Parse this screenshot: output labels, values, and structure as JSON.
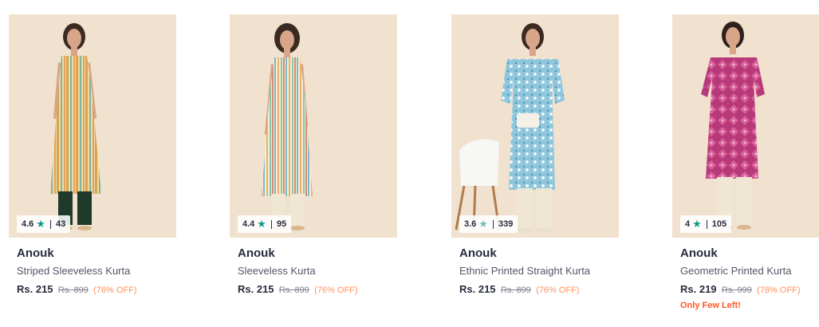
{
  "products": [
    {
      "brand": "Anouk",
      "name": "Striped Sleeveless Kurta",
      "rating": "4.6",
      "rating_count": "43",
      "price": "Rs. 215",
      "mrp": "Rs. 899",
      "discount": "(76% OFF)",
      "stock_note": "",
      "image_icon": "product-image",
      "star_color": "#14958f"
    },
    {
      "brand": "Anouk",
      "name": "Sleeveless Kurta",
      "rating": "4.4",
      "rating_count": "95",
      "price": "Rs. 215",
      "mrp": "Rs. 899",
      "discount": "(76% OFF)",
      "stock_note": "",
      "image_icon": "product-image",
      "star_color": "#14958f"
    },
    {
      "brand": "Anouk",
      "name": "Ethnic Printed Straight Kurta",
      "rating": "3.6",
      "rating_count": "339",
      "price": "Rs. 215",
      "mrp": "Rs. 899",
      "discount": "(76% OFF)",
      "stock_note": "",
      "image_icon": "product-image",
      "star_color": "#72bcb9"
    },
    {
      "brand": "Anouk",
      "name": "Geometric Printed Kurta",
      "rating": "4",
      "rating_count": "105",
      "price": "Rs. 219",
      "mrp": "Rs. 999",
      "discount": "(78% OFF)",
      "stock_note": "Only Few Left!",
      "image_icon": "product-image",
      "star_color": "#14958f"
    }
  ],
  "colors": {
    "accent_star": "#14958f",
    "discount": "#ff905a",
    "stock_warning": "#ff5722",
    "image_background": "#f1e1cf"
  }
}
